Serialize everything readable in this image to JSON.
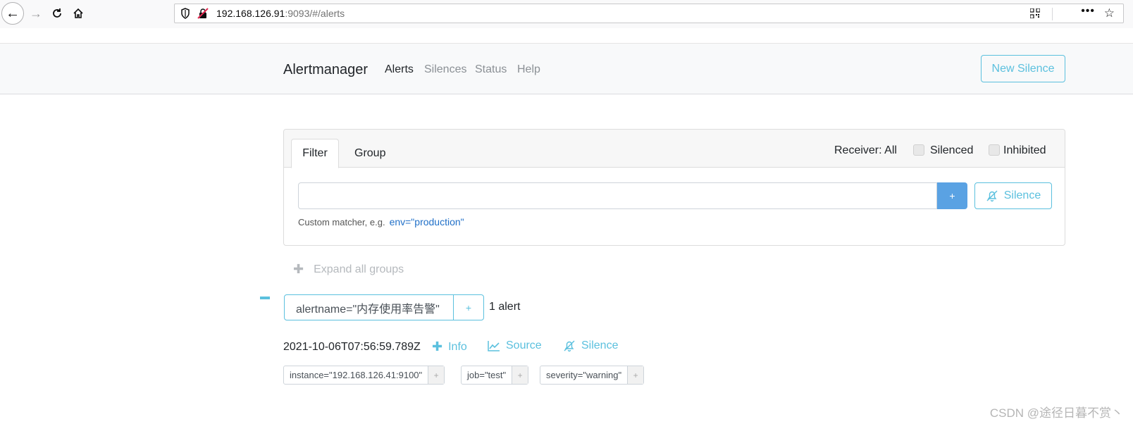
{
  "browser": {
    "url_host": "192.168.126.91",
    "url_rest": ":9093/#/alerts",
    "more_label": "•••"
  },
  "nav": {
    "brand": "Alertmanager",
    "links": [
      "Alerts",
      "Silences",
      "Status",
      "Help"
    ],
    "new_silence": "New Silence"
  },
  "filter": {
    "tabs": [
      "Filter",
      "Group"
    ],
    "receiver": "Receiver: All",
    "silenced_label": "Silenced",
    "inhibited_label": "Inhibited",
    "input_value": "",
    "plus_label": "+",
    "silence_label": "Silence",
    "hint": "Custom matcher, e.g.",
    "hint_example": "env=\"production\""
  },
  "groups": {
    "expand_all": "Expand all groups",
    "group_label": "alertname=\"内存使用率告警\"",
    "group_plus": "+",
    "alert_count": "1 alert"
  },
  "alert": {
    "timestamp": "2021-10-06T07:56:59.789Z",
    "info": "Info",
    "source": "Source",
    "silence": "Silence",
    "labels": [
      "instance=\"192.168.126.41:9100\"",
      "job=\"test\"",
      "severity=\"warning\""
    ],
    "label_plus": "+"
  },
  "watermark": "CSDN @途径日暮不赏丶",
  "colors": {
    "accent": "#5bc0de",
    "primary": "#5aa2e3"
  }
}
